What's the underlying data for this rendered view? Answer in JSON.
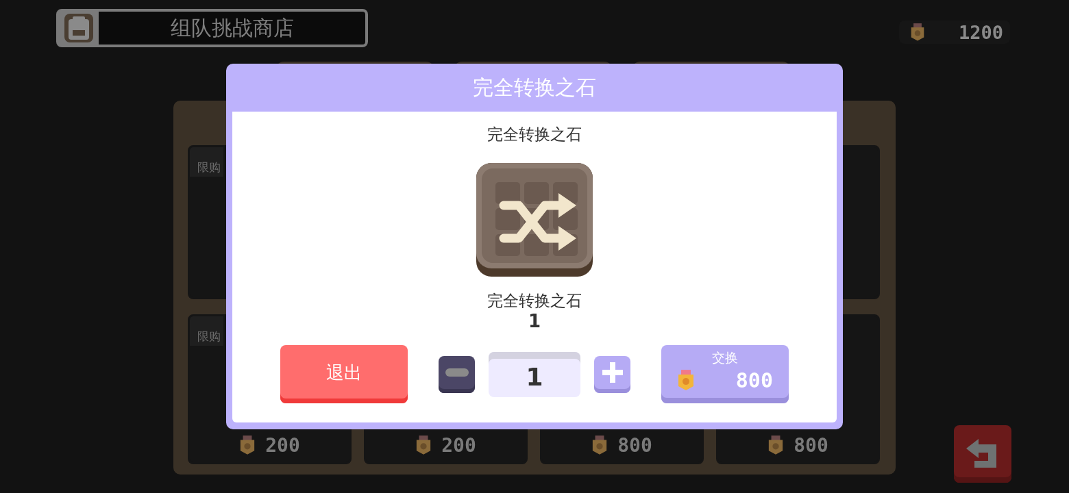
{
  "header": {
    "title": "组队挑战商店"
  },
  "currency": {
    "amount": "1200"
  },
  "shop": {
    "tabs": [
      {
        "selected": false
      },
      {
        "selected": false
      },
      {
        "selected": false
      }
    ],
    "card_rows": [
      [
        {
          "selected": false,
          "limit": "限购"
        },
        {
          "selected": false
        }
      ],
      [
        {
          "selected": false,
          "limit": "限购",
          "price": "200"
        },
        {
          "selected": false,
          "price": "200"
        },
        {
          "selected": false,
          "price": "800"
        },
        {
          "selected": false,
          "price": "800"
        }
      ]
    ]
  },
  "dialog": {
    "title": "完全转换之石",
    "item_name": "完全转换之石",
    "item_caption": "完全转换之石",
    "item_count": "1",
    "cancel_label": "退出",
    "quantity": "1",
    "exchange_label": "交换",
    "exchange_price": "800"
  }
}
